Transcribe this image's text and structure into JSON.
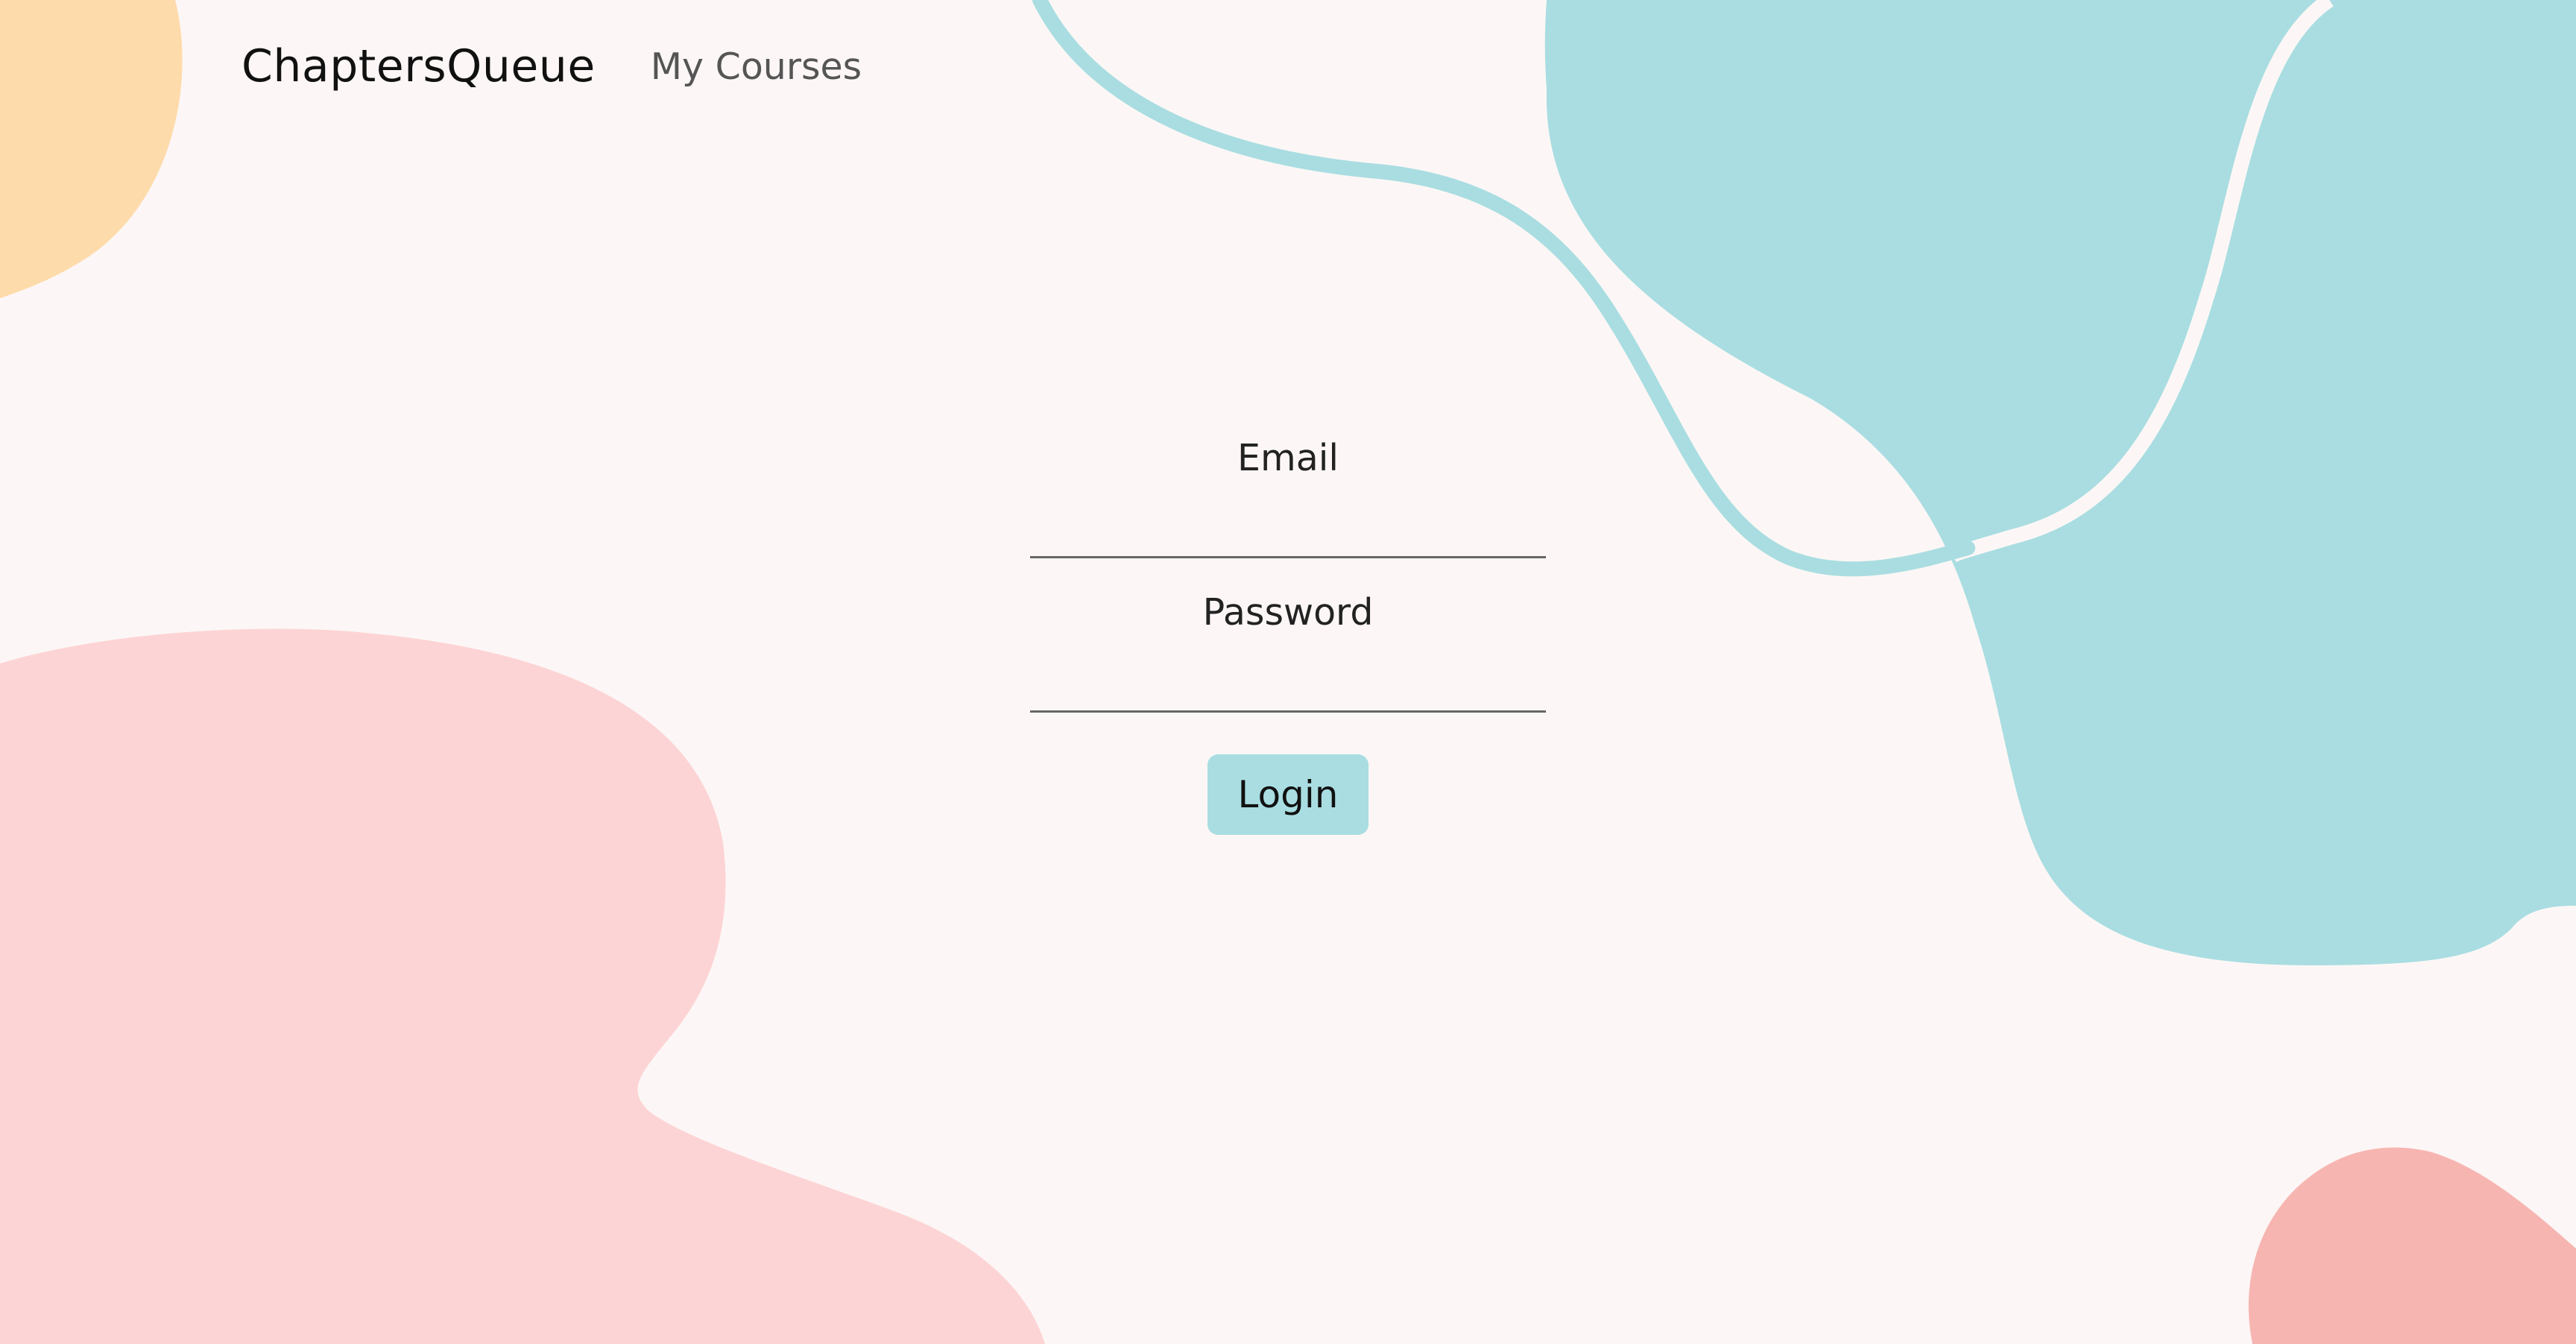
{
  "header": {
    "brand": "ChaptersQueue",
    "nav_link": "My Courses"
  },
  "login_form": {
    "email_label": "Email",
    "email_value": "",
    "password_label": "Password",
    "password_value": "",
    "login_button": "Login"
  },
  "colors": {
    "background": "#fcf7f6",
    "teal_blob": "#a9dde1",
    "teal_line": "#a9dde1",
    "peach_blob": "#fedbaa",
    "pink_blob": "#fdd4d5",
    "coral_blob": "#f7b5b1",
    "button": "#a9dde1"
  }
}
